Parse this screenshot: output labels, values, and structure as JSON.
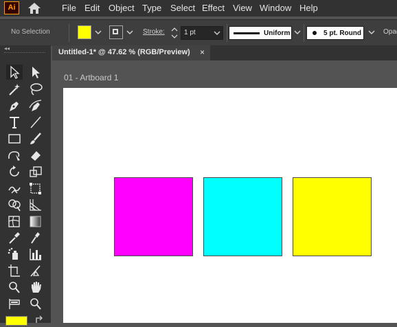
{
  "app": {
    "logo": "Ai"
  },
  "menu": [
    "File",
    "Edit",
    "Object",
    "Type",
    "Select",
    "Effect",
    "View",
    "Window",
    "Help"
  ],
  "control_bar": {
    "selection_status": "No Selection",
    "fill_color": "#ffff00",
    "stroke_label": "Stroke:",
    "stroke_weight": "1 pt",
    "variable_width_profile": "Uniform",
    "brush": "5 pt. Round",
    "opacity_label": "Opac"
  },
  "document_tab": {
    "title": "Untitled-1* @ 47.62 % (RGB/Preview)",
    "close": "×"
  },
  "artboard": {
    "label": "01 - Artboard 1"
  },
  "canvas_shapes": [
    {
      "name": "magenta-square",
      "color": "#ff00ff"
    },
    {
      "name": "cyan-square",
      "color": "#00ffff"
    },
    {
      "name": "yellow-square",
      "color": "#ffff00"
    }
  ],
  "tools": [
    "selection-tool-icon",
    "direct-selection-tool-icon",
    "magic-wand-tool-icon",
    "lasso-tool-icon",
    "pen-tool-icon",
    "curvature-tool-icon",
    "type-tool-icon",
    "line-segment-tool-icon",
    "rectangle-tool-icon",
    "paintbrush-tool-icon",
    "shaper-tool-icon",
    "eraser-tool-icon",
    "rotate-tool-icon",
    "scale-tool-icon",
    "warp-tool-icon",
    "free-transform-tool-icon",
    "shape-builder-tool-icon",
    "perspective-grid-tool-icon",
    "mesh-tool-icon",
    "gradient-tool-icon",
    "eyedropper-tool-icon",
    "blend-tool-icon",
    "symbol-sprayer-tool-icon",
    "column-graph-tool-icon",
    "artboard-tool-icon",
    "slice-tool-icon",
    "hand-tool-icon",
    "zoom-tool-icon"
  ]
}
